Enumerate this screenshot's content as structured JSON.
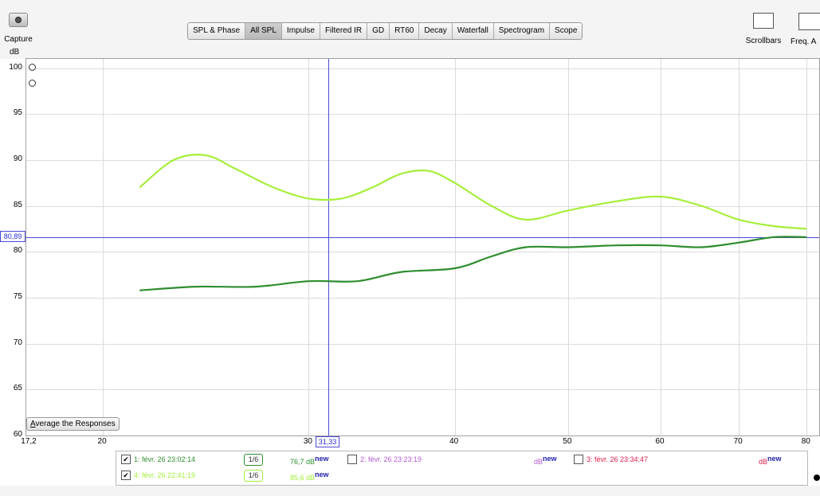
{
  "toolbar": {
    "capture_label": "Capture",
    "scrollbars_label": "Scrollbars",
    "freq_label": "Freq. A",
    "tabs": [
      {
        "label": "SPL & Phase",
        "active": false
      },
      {
        "label": "All SPL",
        "active": true
      },
      {
        "label": "Impulse",
        "active": false
      },
      {
        "label": "Filtered IR",
        "active": false
      },
      {
        "label": "GD",
        "active": false
      },
      {
        "label": "RT60",
        "active": false
      },
      {
        "label": "Decay",
        "active": false
      },
      {
        "label": "Waterfall",
        "active": false
      },
      {
        "label": "Spectrogram",
        "active": false
      },
      {
        "label": "Scope",
        "active": false
      }
    ]
  },
  "graph": {
    "y_unit": "dB",
    "y_ticks": [
      "100",
      "95",
      "90",
      "85",
      "80",
      "75",
      "70",
      "65",
      "60"
    ],
    "x_ticks": [
      "17,2",
      "20",
      "30",
      "40",
      "50",
      "60",
      "70",
      "80"
    ],
    "cursor_y_value": "80,89",
    "cursor_x_value": "31,33",
    "average_button": {
      "underlined": "A",
      "rest": "verage the Responses"
    }
  },
  "chart_data": {
    "type": "line",
    "xlabel": "",
    "ylabel": "dB",
    "ylim": [
      60,
      101
    ],
    "xlim": [
      17.2,
      82
    ],
    "x_scale": "log",
    "series": [
      {
        "name": "4: févr. 26 22:41:19",
        "color": "#a6ef3a",
        "x": [
          21.5,
          23,
          24.5,
          26,
          28,
          30,
          32,
          34,
          36,
          38,
          40,
          43,
          46,
          50,
          55,
          60,
          65,
          70,
          75,
          80
        ],
        "values": [
          87,
          90,
          90.5,
          89,
          87,
          85.8,
          85.8,
          87,
          88.5,
          88.8,
          87.5,
          85,
          83.5,
          84.5,
          85.5,
          86,
          85,
          83.5,
          82.8,
          82.5
        ]
      },
      {
        "name": "1: févr. 26 23:02:14",
        "color": "#2f8e2f",
        "x": [
          21.5,
          24,
          27,
          30,
          33,
          36,
          40,
          43,
          46,
          50,
          55,
          60,
          65,
          70,
          75,
          80
        ],
        "values": [
          75.8,
          76.2,
          76.2,
          76.8,
          76.8,
          77.8,
          78.2,
          79.5,
          80.5,
          80.5,
          80.7,
          80.7,
          80.5,
          81,
          81.6,
          81.6
        ]
      }
    ]
  },
  "legend": {
    "items": [
      {
        "label": "1: févr. 26 23:02:14",
        "checked": true,
        "smoothing": "1/6",
        "value": "76,7 dB",
        "new": "new",
        "color": "#2f8e2f"
      },
      {
        "label": "2: févr. 26 23:23:19",
        "checked": false,
        "value": "dB",
        "new": "new",
        "color": "#b35ad0"
      },
      {
        "label": "3: févr. 26 23:34:47",
        "checked": false,
        "value": "dB",
        "new": "new",
        "color": "#e0204a"
      },
      {
        "label": "4: févr. 26 22:41:19",
        "checked": true,
        "smoothing": "1/6",
        "value": "85,6 dB",
        "new": "new",
        "color": "#a6ef3a"
      }
    ]
  },
  "colors": {
    "cursor": "#4a4ad8",
    "grid": "#dcdcdc"
  }
}
